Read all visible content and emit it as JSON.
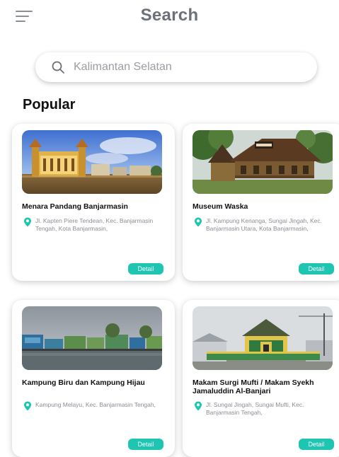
{
  "header": {
    "title": "Search",
    "menu_icon": "hamburger-menu-icon"
  },
  "search": {
    "placeholder": "Kalimantan Selatan",
    "icon": "search-icon"
  },
  "section": {
    "title": "Popular"
  },
  "colors": {
    "accent": "#1ec6b2",
    "title_gray": "#6b7079",
    "muted_text": "#8a8f96"
  },
  "places": [
    {
      "name": "Menara Pandang Banjarmasin",
      "address": "Jl. Kapten Piere Tendean, Kec. Banjarmasin Tengah, Kota Banjarmasin,",
      "detail_label": "Detail"
    },
    {
      "name": "Museum Waska",
      "address": "Jl. Kampung Kenanga, Sungai Jingah, Kec. Banjarmasin Utara, Kota Banjarmasin,",
      "detail_label": "Detail"
    },
    {
      "name": "Kampung Biru dan Kampung Hijau",
      "address": "Kampung Melayu, Kec. Banjarmasin Tengah,",
      "detail_label": "Detail"
    },
    {
      "name": "Makam Surgi Mufti / Makam Syekh Jamaluddin Al-Banjari",
      "address": "Jl. Sungai Jingah, Sungai Mufti, Kec. Banjarmasin Tengah,",
      "detail_label": "Detail"
    }
  ]
}
